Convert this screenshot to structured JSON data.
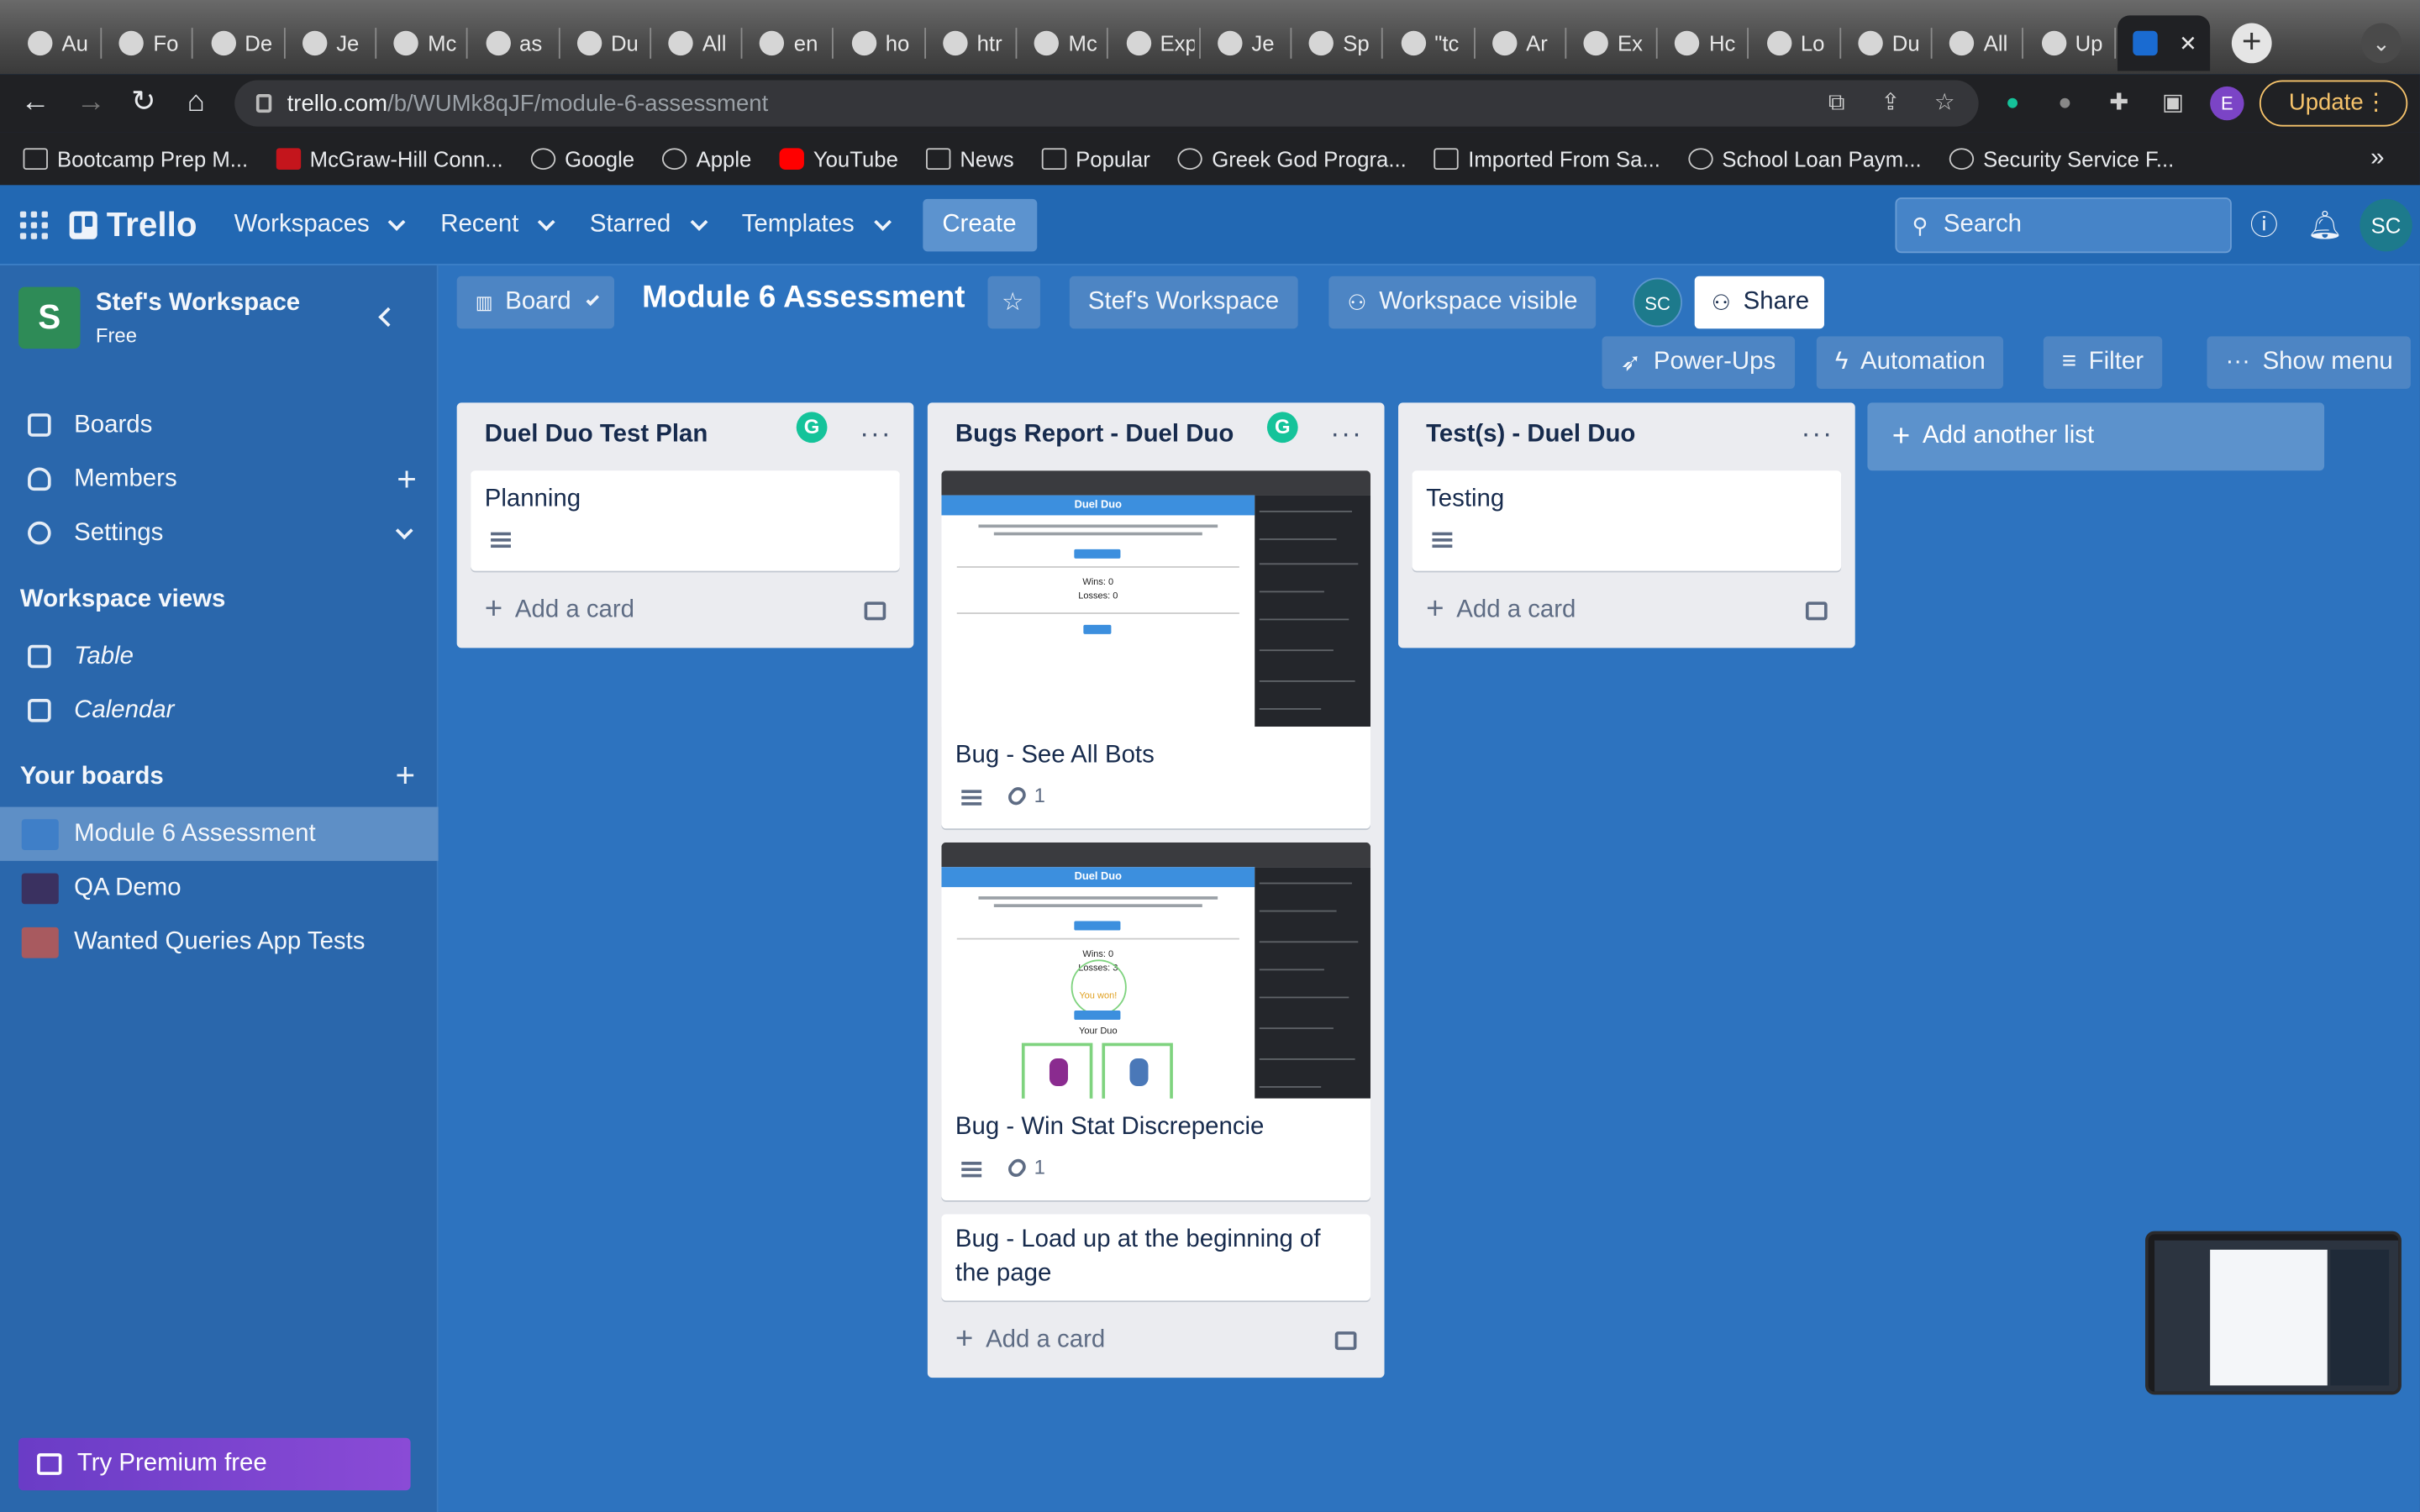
{
  "browser": {
    "tabs": [
      {
        "label": "Au"
      },
      {
        "label": "Fo"
      },
      {
        "label": "De"
      },
      {
        "label": "Je"
      },
      {
        "label": "Mc"
      },
      {
        "label": "as"
      },
      {
        "label": "Du"
      },
      {
        "label": "All"
      },
      {
        "label": "en"
      },
      {
        "label": "ho"
      },
      {
        "label": "htr"
      },
      {
        "label": "Mc"
      },
      {
        "label": "Exp"
      },
      {
        "label": "Je"
      },
      {
        "label": "Sp"
      },
      {
        "label": "\"tc"
      },
      {
        "label": "Ar"
      },
      {
        "label": "Ex"
      },
      {
        "label": "Hc"
      },
      {
        "label": "Lo"
      },
      {
        "label": "Du"
      },
      {
        "label": "All"
      },
      {
        "label": "Up"
      }
    ],
    "active_tab_close": "✕",
    "new_tab": "+",
    "url_domain": "trello.com",
    "url_path": "/b/WUMk8qJF/module-6-assessment",
    "profile_initial": "E",
    "update_label": "Update",
    "bookmarks": [
      {
        "label": "Bootcamp Prep M...",
        "icon": "folder-icon"
      },
      {
        "label": "McGraw-Hill Conn...",
        "icon": "mcgraw-hill-icon"
      },
      {
        "label": "Google",
        "icon": "google-icon"
      },
      {
        "label": "Apple",
        "icon": "apple-icon"
      },
      {
        "label": "YouTube",
        "icon": "youtube-icon"
      },
      {
        "label": "News",
        "icon": "folder-icon"
      },
      {
        "label": "Popular",
        "icon": "folder-icon"
      },
      {
        "label": "Greek God Progra...",
        "icon": "k-icon"
      },
      {
        "label": "Imported From Sa...",
        "icon": "folder-icon"
      },
      {
        "label": "School Loan Paym...",
        "icon": "n-icon"
      },
      {
        "label": "Security Service F...",
        "icon": "ssf-icon"
      }
    ],
    "bookmarks_more": "»"
  },
  "header": {
    "logo": "Trello",
    "nav": [
      {
        "label": "Workspaces"
      },
      {
        "label": "Recent"
      },
      {
        "label": "Starred"
      },
      {
        "label": "Templates"
      }
    ],
    "create_label": "Create",
    "search_placeholder": "Search",
    "avatar_initials": "SC"
  },
  "sidebar": {
    "workspace_initial": "S",
    "workspace_name": "Stef's Workspace",
    "workspace_plan": "Free",
    "items": [
      {
        "label": "Boards"
      },
      {
        "label": "Members"
      },
      {
        "label": "Settings"
      }
    ],
    "views_heading": "Workspace views",
    "views": [
      {
        "label": "Table"
      },
      {
        "label": "Calendar"
      }
    ],
    "boards_heading": "Your boards",
    "boards": [
      {
        "label": "Module 6 Assessment",
        "color": "#3f7fc8"
      },
      {
        "label": "QA Demo",
        "color": "#3a3160"
      },
      {
        "label": "Wanted Queries App Tests",
        "color": "#a85a5f"
      }
    ],
    "premium_label": "Try Premium free"
  },
  "board": {
    "view_label": "Board",
    "title": "Module 6 Assessment",
    "workspace_label": "Stef's Workspace",
    "visibility_label": "Workspace visible",
    "member_initials": "SC",
    "share_label": "Share",
    "powerups_label": "Power-Ups",
    "automation_label": "Automation",
    "filter_label": "Filter",
    "menu_label": "Show menu",
    "add_list_label": "Add another list",
    "lists": [
      {
        "title": "Duel Duo Test Plan",
        "cards": [
          {
            "title": "Planning"
          }
        ],
        "add_card": "Add a card"
      },
      {
        "title": "Bugs Report - Duel Duo",
        "cards": [
          {
            "title": "Bug - See All Bots",
            "attachments": "1"
          },
          {
            "title": "Bug - Win Stat Discrepencie",
            "attachments": "1"
          },
          {
            "title": "Bug - Load up at the beginning of the page"
          }
        ],
        "add_card": "Add a card"
      },
      {
        "title": "Test(s) - Duel Duo",
        "cards": [
          {
            "title": "Testing"
          }
        ],
        "add_card": "Add a card"
      }
    ]
  },
  "thumbnails": {
    "app_title": "Duel Duo",
    "wins": "Wins: 0",
    "losses_first": "Losses: 0",
    "losses_second": "Losses: 3",
    "you_won": "You won!",
    "your_duo": "Your Duo"
  },
  "colors": {
    "board_bg": "#2d73bf",
    "header_bg": "#2268b3",
    "premium": "#7a44d0",
    "grammarly": "#15c39a",
    "update_accent": "#f6c36b"
  }
}
